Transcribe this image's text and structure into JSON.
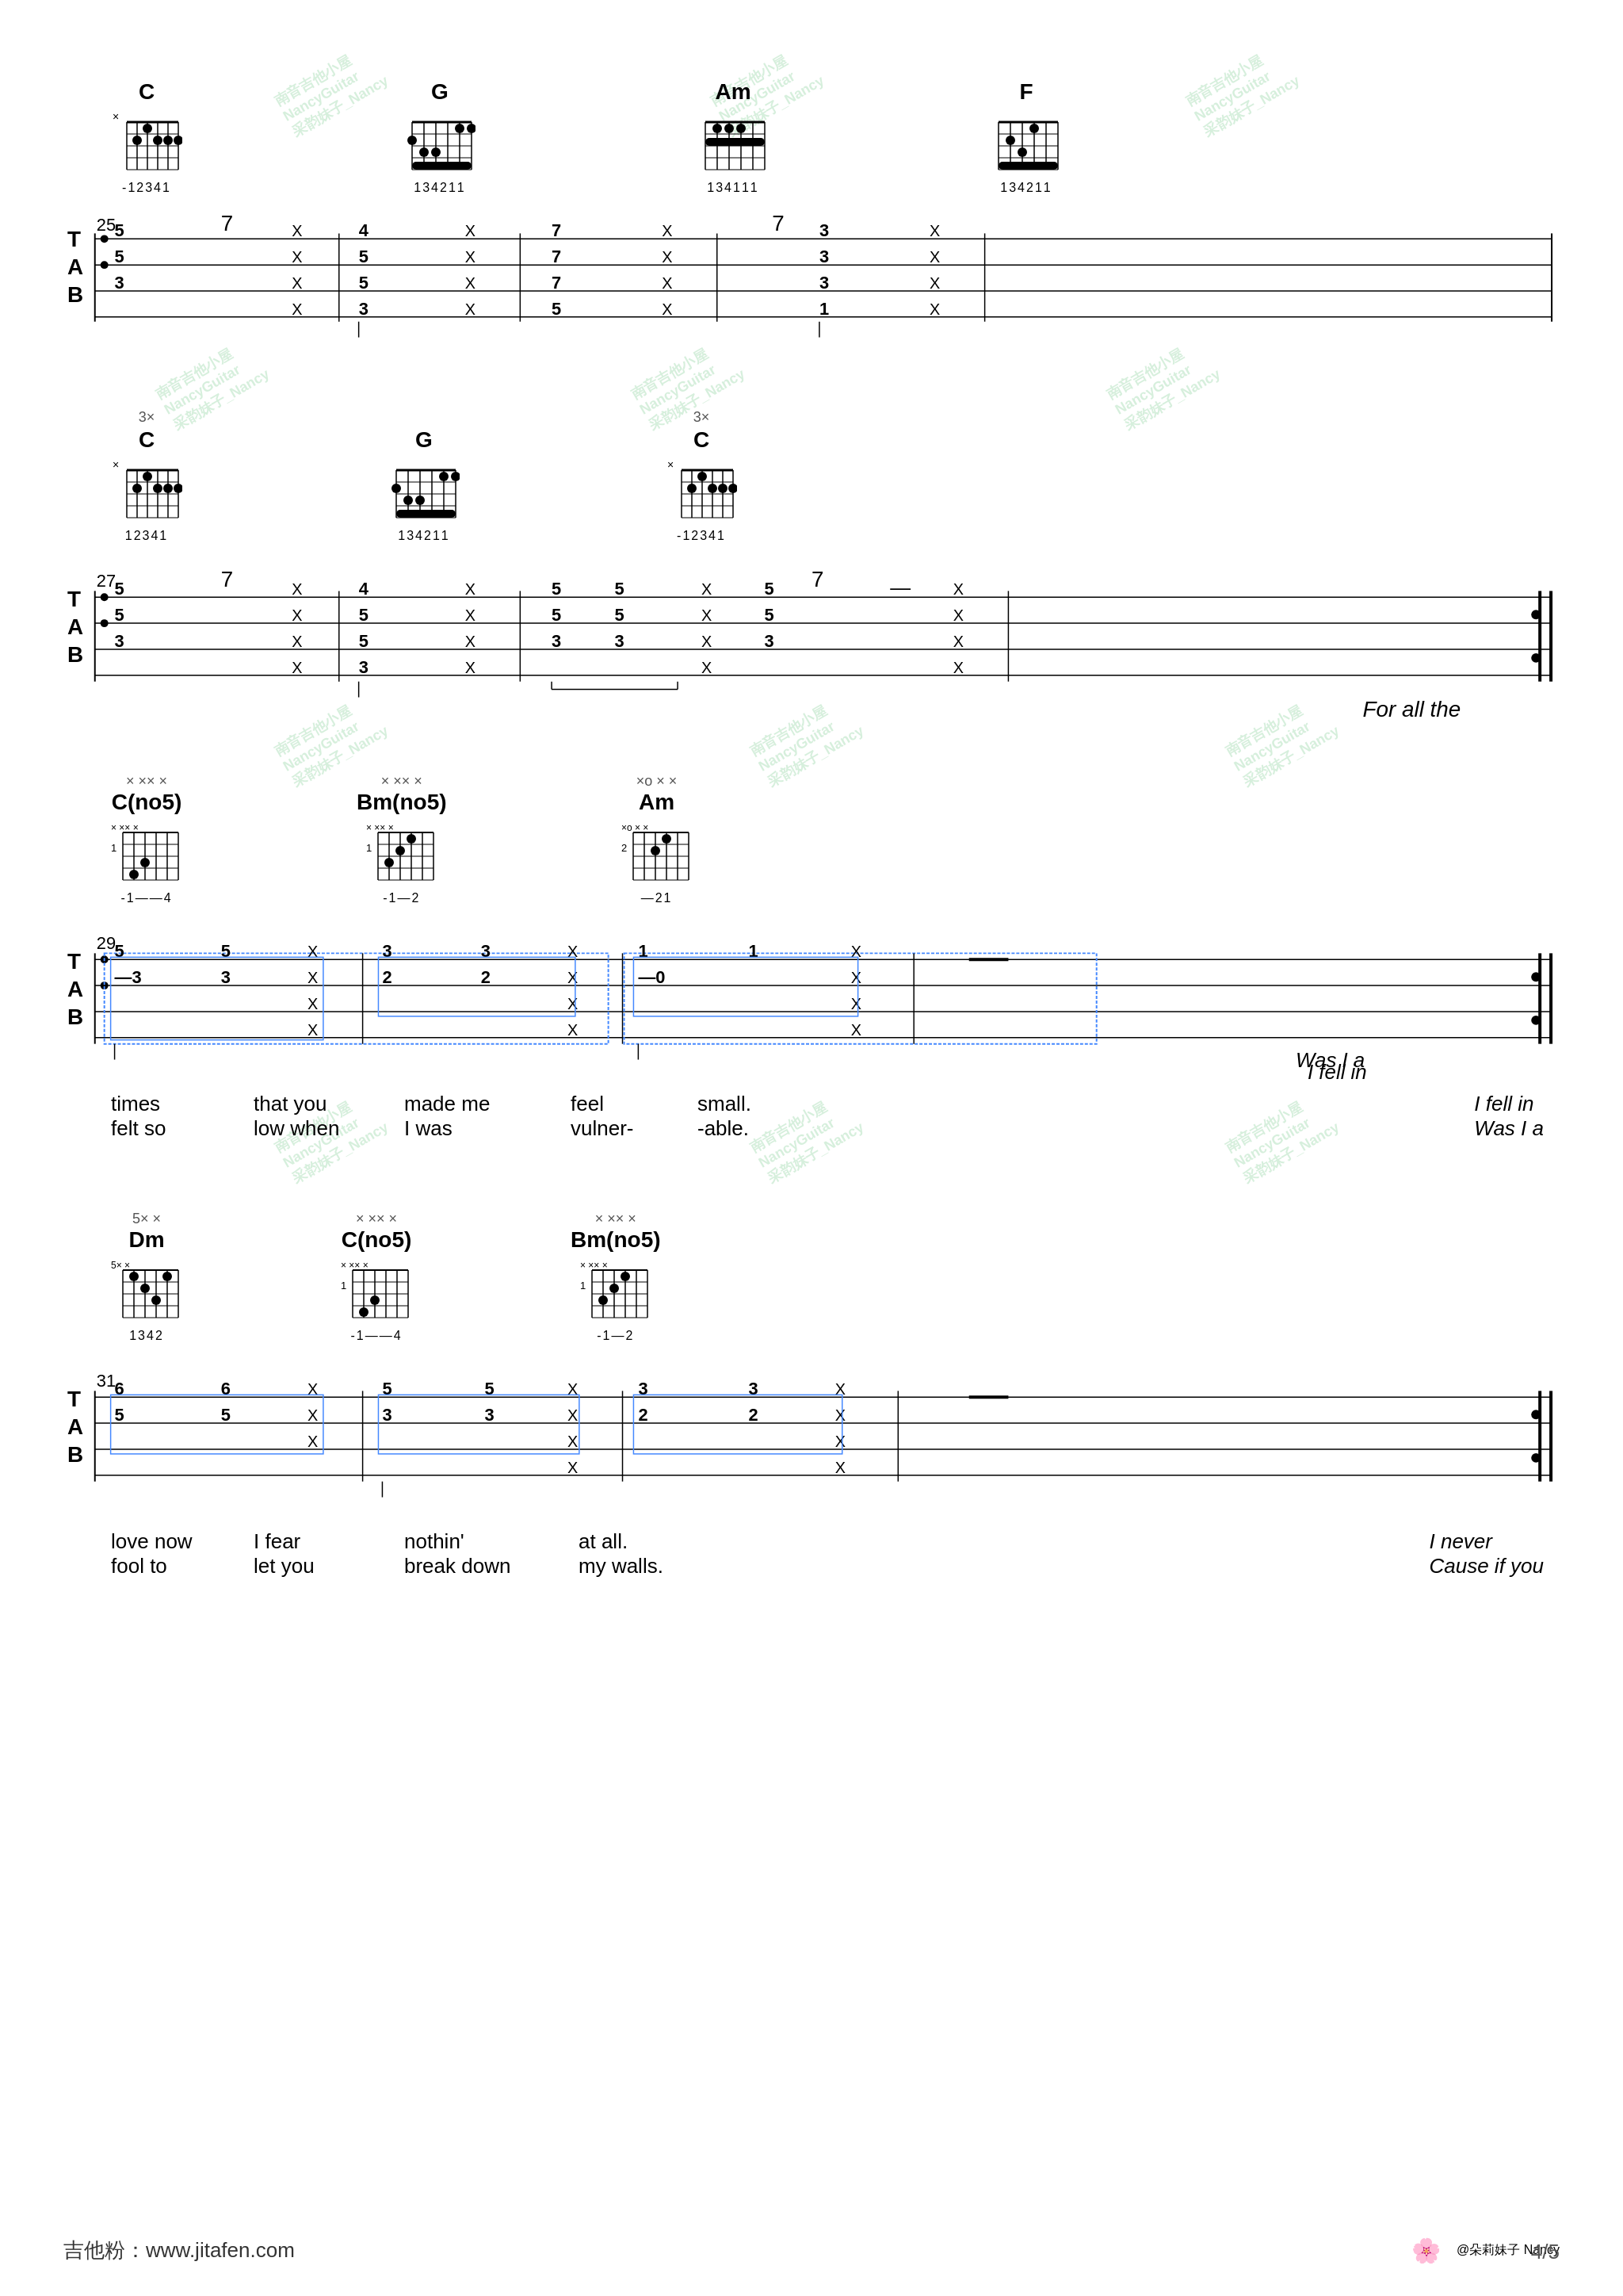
{
  "page": {
    "number": "4/5",
    "footer_url": "吉他粉：www.jitafen.com",
    "footer_brand": "@朵莉妹子 Nancy"
  },
  "sections": [
    {
      "id": "sec1",
      "measure_start": 25,
      "chords": [
        {
          "name": "C",
          "fret_marker": "×",
          "position": "1",
          "fingers": "12341"
        },
        {
          "name": "G",
          "fret_marker": "",
          "position": "1",
          "fingers": "134211"
        },
        {
          "name": "Am",
          "fret_marker": "",
          "position": "1",
          "fingers": "134111"
        },
        {
          "name": "F",
          "fret_marker": "",
          "position": "1",
          "fingers": "134211"
        }
      ],
      "tab_lines": {
        "strings": [
          {
            "label": "T",
            "notes": "• 5 ——————————— 7 ——— 4 ——————————— X ——————————————————————— 7 ——— 3 ——— X"
          },
          {
            "label": "A",
            "notes": "• 5 ——————————— X ——— 5 ——————————— X ——— 7 ——————————— X ——— 3 ——— X"
          },
          {
            "label": "B",
            "notes": "  3 ——————————— X ——— 5 ——————————— X ——— 7 ——————————— X ——— 3 ——— X"
          },
          {
            "label": "",
            "notes": "                X ——— 3 ——————————— X ——— 5 ——————————— X ——— 1 ——— X"
          }
        ]
      },
      "right_text": ""
    },
    {
      "id": "sec2",
      "measure_start": 27,
      "chords": [
        {
          "name": "C",
          "fret_marker": "3×",
          "position": "1",
          "fingers": "12341"
        },
        {
          "name": "G",
          "fret_marker": "",
          "position": "1",
          "fingers": "134211"
        },
        {
          "name": "C",
          "fret_marker": "3×",
          "position": "1",
          "fingers": "12341"
        }
      ],
      "tab_lines": {},
      "right_text": "For all the"
    },
    {
      "id": "sec3",
      "measure_start": 29,
      "chords": [
        {
          "name": "C(no5)",
          "fret_marker": "× ×× ×",
          "position": "1",
          "fingers": "14"
        },
        {
          "name": "Bm(no5)",
          "fret_marker": "× ×× ×",
          "position": "1",
          "fingers": "12"
        },
        {
          "name": "Am",
          "fret_marker": "×o × ×",
          "position": "2",
          "fingers": "21"
        }
      ],
      "lyrics": [
        {
          "line1": "times",
          "line2": "felt so"
        },
        {
          "line1": "that you",
          "line2": "low when"
        },
        {
          "line1": "made me",
          "line2": "I was"
        },
        {
          "line1": "feel",
          "line2": "vulner-"
        },
        {
          "line1": "small.",
          "line2": "-able."
        }
      ],
      "right_text1": "I fell in",
      "right_text2": "Was I a"
    },
    {
      "id": "sec4",
      "measure_start": 31,
      "chords": [
        {
          "name": "Dm",
          "fret_marker": "5× ×",
          "position": "1",
          "fingers": "1342"
        },
        {
          "name": "C(no5)",
          "fret_marker": "× ×× ×",
          "position": "1",
          "fingers": "14"
        },
        {
          "name": "Bm(no5)",
          "fret_marker": "× ×× ×",
          "position": "1",
          "fingers": "12"
        }
      ],
      "lyrics_line1": [
        "love now",
        "I fear",
        "nothin'",
        "at all."
      ],
      "lyrics_line2": [
        "fool to",
        "let you",
        "break down",
        "my walls."
      ],
      "right_text1": "I never",
      "right_text2": "Cause if you"
    }
  ]
}
